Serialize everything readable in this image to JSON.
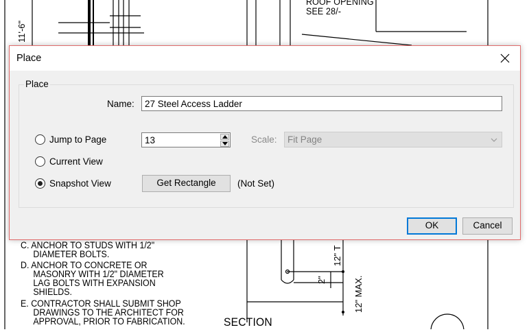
{
  "background": {
    "top_right_notes": [
      "ROOF OPENING",
      "SEE 28/-"
    ],
    "left_dimension": "11'-6\"",
    "notes": [
      {
        "letter": "C.",
        "lines": [
          "ANCHOR TO STUDS WITH 1/2\"",
          "DIAMETER BOLTS."
        ]
      },
      {
        "letter": "D.",
        "lines": [
          "ANCHOR TO CONCRETE OR",
          "MASONRY WITH 1/2\" DIAMETER",
          "LAG BOLTS WITH EXPANSION",
          "SHIELDS."
        ]
      },
      {
        "letter": "E.",
        "lines": [
          "CONTRACTOR SHALL SUBMIT SHOP",
          "DRAWINGS TO THE ARCHITECT FOR",
          "APPROVAL, PRIOR TO FABRICATION."
        ]
      }
    ],
    "section_label": "SECTION",
    "dim_12_top": "12\" T",
    "dim_2": "2\"",
    "dim_12_max": "12\" MAX."
  },
  "dialog": {
    "title": "Place",
    "group_label": "Place",
    "name_label": "Name:",
    "name_value": "27 Steel Access Ladder",
    "options": {
      "jump_to_page": "Jump to Page",
      "current_view": "Current View",
      "snapshot_view": "Snapshot View",
      "selected": "snapshot_view"
    },
    "page_value": "13",
    "scale_label": "Scale:",
    "scale_value": "Fit Page",
    "get_rectangle_label": "Get Rectangle",
    "rect_status": "(Not Set)",
    "ok_label": "OK",
    "cancel_label": "Cancel",
    "colors": {
      "dialog_border": "#e06b6b",
      "default_button_border": "#0078d7"
    }
  }
}
